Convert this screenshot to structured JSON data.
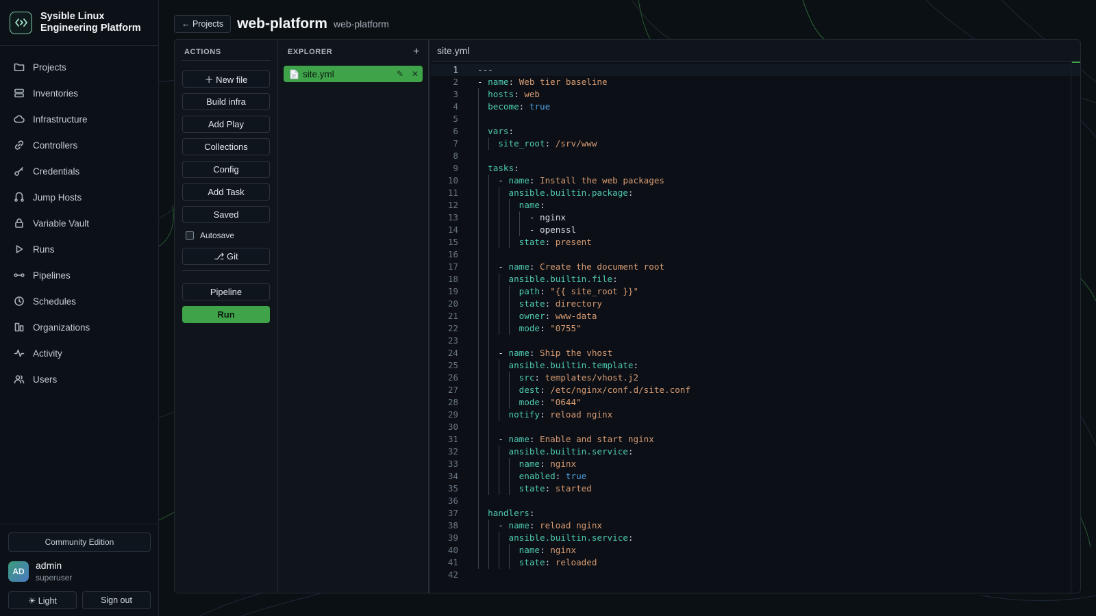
{
  "brand": {
    "title": "Sysible Linux Engineering Platform"
  },
  "nav": [
    {
      "label": "Projects",
      "icon": "folder-icon"
    },
    {
      "label": "Inventories",
      "icon": "server-icon"
    },
    {
      "label": "Infrastructure",
      "icon": "cloud-icon"
    },
    {
      "label": "Controllers",
      "icon": "link-icon"
    },
    {
      "label": "Credentials",
      "icon": "key-icon"
    },
    {
      "label": "Jump Hosts",
      "icon": "route-icon"
    },
    {
      "label": "Variable Vault",
      "icon": "lock-icon"
    },
    {
      "label": "Runs",
      "icon": "play-icon"
    },
    {
      "label": "Pipelines",
      "icon": "pipeline-icon"
    },
    {
      "label": "Schedules",
      "icon": "clock-icon"
    },
    {
      "label": "Organizations",
      "icon": "building-icon"
    },
    {
      "label": "Activity",
      "icon": "activity-icon"
    },
    {
      "label": "Users",
      "icon": "users-icon"
    }
  ],
  "footer": {
    "edition": "Community Edition",
    "user": {
      "initials": "AD",
      "name": "admin",
      "role": "superuser"
    },
    "theme_label": "☀ Light",
    "signout_label": "Sign out"
  },
  "header": {
    "back_label": "← Projects",
    "title": "web-platform",
    "subtitle": "web-platform"
  },
  "actions": {
    "heading": "ACTIONS",
    "buttons": [
      "＋ New file",
      "Build infra",
      "Add Play",
      "Collections",
      "Config",
      "Add Task",
      "Saved"
    ],
    "autosave_label": "Autosave",
    "autosave_checked": false,
    "git_label": "⎇ Git",
    "pipeline_label": "Pipeline",
    "run_label": "Run"
  },
  "explorer": {
    "heading": "EXPLORER",
    "add_symbol": "+",
    "files": [
      {
        "name": "site.yml",
        "edit_symbol": "✎",
        "close_symbol": "✕"
      }
    ]
  },
  "editor": {
    "tab": "site.yml",
    "lines": [
      "---",
      "- name: Web tier baseline",
      "  hosts: web",
      "  become: true",
      "",
      "  vars:",
      "    site_root: /srv/www",
      "",
      "  tasks:",
      "    - name: Install the web packages",
      "      ansible.builtin.package:",
      "        name:",
      "          - nginx",
      "          - openssl",
      "        state: present",
      "",
      "    - name: Create the document root",
      "      ansible.builtin.file:",
      "        path: \"{{ site_root }}\"",
      "        state: directory",
      "        owner: www-data",
      "        mode: \"0755\"",
      "",
      "    - name: Ship the vhost",
      "      ansible.builtin.template:",
      "        src: templates/vhost.j2",
      "        dest: /etc/nginx/conf.d/site.conf",
      "        mode: \"0644\"",
      "      notify: reload nginx",
      "",
      "    - name: Enable and start nginx",
      "      ansible.builtin.service:",
      "        name: nginx",
      "        enabled: true",
      "        state: started",
      "",
      "  handlers:",
      "    - name: reload nginx",
      "      ansible.builtin.service:",
      "        name: nginx",
      "        state: reloaded",
      ""
    ],
    "active_line": 1
  },
  "colors": {
    "accent": "#3fa34a",
    "key": "#4ec9b0",
    "string": "#d79a72",
    "boolean": "#4f9fe3"
  }
}
